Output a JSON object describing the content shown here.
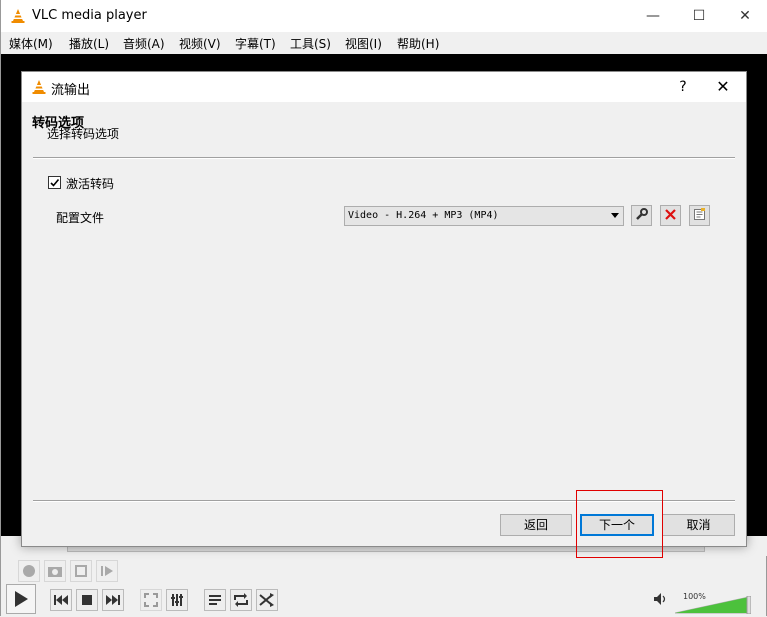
{
  "window": {
    "title": "VLC media player",
    "minimize_icon": "minimize-icon",
    "maximize_icon": "maximize-icon",
    "close_icon": "close-icon"
  },
  "menu": [
    "媒体(M)",
    "播放(L)",
    "音频(A)",
    "视频(V)",
    "字幕(T)",
    "工具(S)",
    "视图(I)",
    "帮助(H)"
  ],
  "volume": {
    "percent_label": "100%",
    "level": 1.0
  },
  "dialog": {
    "title": "流输出",
    "help": "?",
    "section_title": "转码选项",
    "section_subtitle": "选择转码选项",
    "activate_transcode": {
      "label": "激活转码",
      "checked": true
    },
    "profile": {
      "label": "配置文件",
      "value": "Video - H.264 + MP3 (MP4)"
    },
    "buttons": {
      "back": "返回",
      "next": "下一个",
      "cancel": "取消"
    }
  },
  "colors": {
    "focus_border": "#0078d7",
    "highlight_box": "#e00000",
    "vlc_orange": "#f08c00",
    "volume_green": "#4cc13c"
  }
}
